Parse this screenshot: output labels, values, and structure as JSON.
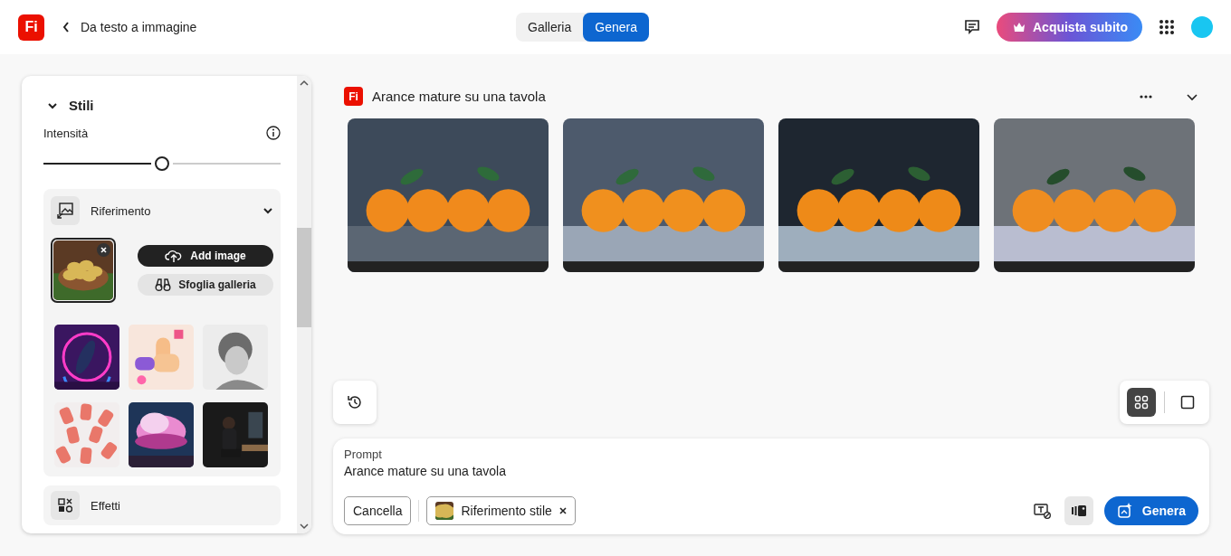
{
  "app": {
    "logo": "Fi",
    "back_label": "Da testo a immagine"
  },
  "mode_tabs": [
    {
      "label": "Galleria",
      "selected": false
    },
    {
      "label": "Genera",
      "selected": true
    }
  ],
  "buy_button": "Acquista subito",
  "panel": {
    "title": "Stili",
    "expanded": true,
    "intensity": {
      "label": "Intensità",
      "level": 0.5
    },
    "reference": {
      "title": "Riferimento",
      "expanded": true,
      "add_button": "Add image",
      "browse_button": "Sfoglia galleria"
    },
    "next_section": {
      "title": "Effetti"
    }
  },
  "results": {
    "logo": "Fi",
    "title": "Arance mature su una tavola"
  },
  "view_toggle": [
    {
      "kind": "grid",
      "selected": true
    },
    {
      "kind": "single",
      "selected": false
    }
  ],
  "prompt": {
    "label": "Prompt",
    "value": "Arance mature su una tavola",
    "clear_button": "Cancella",
    "style_chip": "Riferimento stile",
    "generate_button": "Genera"
  }
}
